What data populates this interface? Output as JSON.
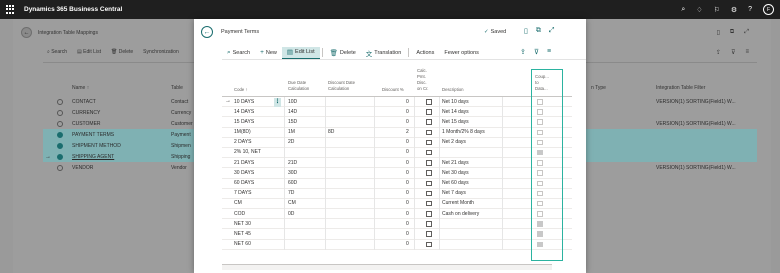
{
  "app": {
    "title": "Dynamics 365 Business Central",
    "avatar": "F"
  },
  "background": {
    "breadcrumb": "Integration Table Mappings",
    "actions": [
      "Search",
      "Edit List",
      "Delete",
      "Synchronization"
    ],
    "headers": {
      "name": "Name ↑",
      "table": "Table",
      "type_partial": "n Type",
      "filter": "Integration Table Filter"
    },
    "rows": [
      {
        "name": "CONTACT",
        "table": "Contact",
        "filter": "VERSION(1) SORTING(Field1) W...",
        "selected": false
      },
      {
        "name": "CURRENCY",
        "table": "Currency",
        "filter": "",
        "selected": false
      },
      {
        "name": "CUSTOMER",
        "table": "Customer",
        "filter": "VERSION(1) SORTING(Field1) W...",
        "selected": false
      },
      {
        "name": "PAYMENT TERMS",
        "table": "Payment",
        "filter": "",
        "selected": true
      },
      {
        "name": "SHIPMENT METHOD",
        "table": "Shipmen",
        "filter": "",
        "selected": true
      },
      {
        "name": "SHIPPING AGENT",
        "table": "Shipping",
        "filter": "",
        "selected": true
      },
      {
        "name": "VENDOR",
        "table": "Vendor",
        "filter": "VERSION(1) SORTING(Field1) W...",
        "selected": false
      }
    ]
  },
  "modal": {
    "title": "Payment Terms",
    "saved": "Saved",
    "toolbar": {
      "search": "Search",
      "new": "New",
      "edit_list": "Edit List",
      "delete": "Delete",
      "translation": "Translation",
      "actions": "Actions",
      "fewer_options": "Fewer options"
    },
    "columns": {
      "code": "Code ↑",
      "due_date": [
        "Due Date",
        "Calculation"
      ],
      "discount_date": [
        "Discount Date",
        "Calculation"
      ],
      "discount_pct": "Discount %",
      "calc_pmt": [
        "Calc.",
        "Pmt.",
        "Disc.",
        "on Cr."
      ],
      "description": "Description",
      "coupled": [
        "Coup...",
        "to",
        "Data..."
      ]
    },
    "rows": [
      {
        "code": "10 DAYS",
        "due": "10D",
        "disc": "",
        "pct": "0",
        "desc": "Net 10 days",
        "coupled": false,
        "current": true
      },
      {
        "code": "14 DAYS",
        "due": "14D",
        "disc": "",
        "pct": "0",
        "desc": "Net 14 days",
        "coupled": false
      },
      {
        "code": "15 DAYS",
        "due": "15D",
        "disc": "",
        "pct": "0",
        "desc": "Net 15 days",
        "coupled": false
      },
      {
        "code": "1M(8D)",
        "due": "1M",
        "disc": "8D",
        "pct": "2",
        "desc": "1 Month/2% 8 days",
        "coupled": false
      },
      {
        "code": "2 DAYS",
        "due": "2D",
        "disc": "",
        "pct": "0",
        "desc": "Net 2 days",
        "coupled": false
      },
      {
        "code": "2% 10, NET",
        "due": "",
        "disc": "",
        "pct": "0",
        "desc": "",
        "coupled": true
      },
      {
        "code": "21 DAYS",
        "due": "21D",
        "disc": "",
        "pct": "0",
        "desc": "Net 21 days",
        "coupled": false
      },
      {
        "code": "30 DAYS",
        "due": "30D",
        "disc": "",
        "pct": "0",
        "desc": "Net 30 days",
        "coupled": false
      },
      {
        "code": "60 DAYS",
        "due": "60D",
        "disc": "",
        "pct": "0",
        "desc": "Net 60 days",
        "coupled": false
      },
      {
        "code": "7 DAYS",
        "due": "7D",
        "disc": "",
        "pct": "0",
        "desc": "Net 7 days",
        "coupled": false
      },
      {
        "code": "CM",
        "due": "CM",
        "disc": "",
        "pct": "0",
        "desc": "Current Month",
        "coupled": false
      },
      {
        "code": "COD",
        "due": "0D",
        "disc": "",
        "pct": "0",
        "desc": "Cash on delivery",
        "coupled": false
      },
      {
        "code": "NET 30",
        "due": "",
        "disc": "",
        "pct": "0",
        "desc": "",
        "coupled": true
      },
      {
        "code": "NET 45",
        "due": "",
        "disc": "",
        "pct": "0",
        "desc": "",
        "coupled": true
      },
      {
        "code": "NET 60",
        "due": "",
        "disc": "",
        "pct": "0",
        "desc": "",
        "coupled": true
      }
    ]
  }
}
